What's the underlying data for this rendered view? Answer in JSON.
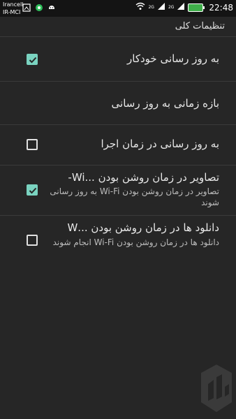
{
  "status_bar": {
    "carrier_1": "Irancell",
    "carrier_2": "IR-MCI",
    "net_1": "2G",
    "net_2": "2G",
    "time": "22:48"
  },
  "settings": {
    "category_title": "تنظیمات کلی",
    "items": [
      {
        "title": "به روز رسانی خودکار",
        "summary": "",
        "checked": true
      },
      {
        "title": "بازه زمانی به روز رسانی",
        "summary": ""
      },
      {
        "title": "به روز رسانی در زمان اجرا",
        "summary": "",
        "checked": false
      },
      {
        "title": "تصاویر در زمان روشن بودن ...Wi-",
        "summary": "تصاویر در زمان روشن بودن Wi-Fi به روز رسانی شوند",
        "checked": true
      },
      {
        "title": "دانلود ها در زمان روشن بودن ...W",
        "summary": "دانلود ها در زمان روشن بودن Wi-Fi انجام شوند",
        "checked": false
      }
    ]
  },
  "icons": {
    "check": "checkmark-icon",
    "wifi": "wifi-icon",
    "signal": "signal-icon",
    "battery": "battery-icon"
  },
  "colors": {
    "background": "#262626",
    "accent": "#7ad3c0",
    "statusbar": "#141414"
  }
}
